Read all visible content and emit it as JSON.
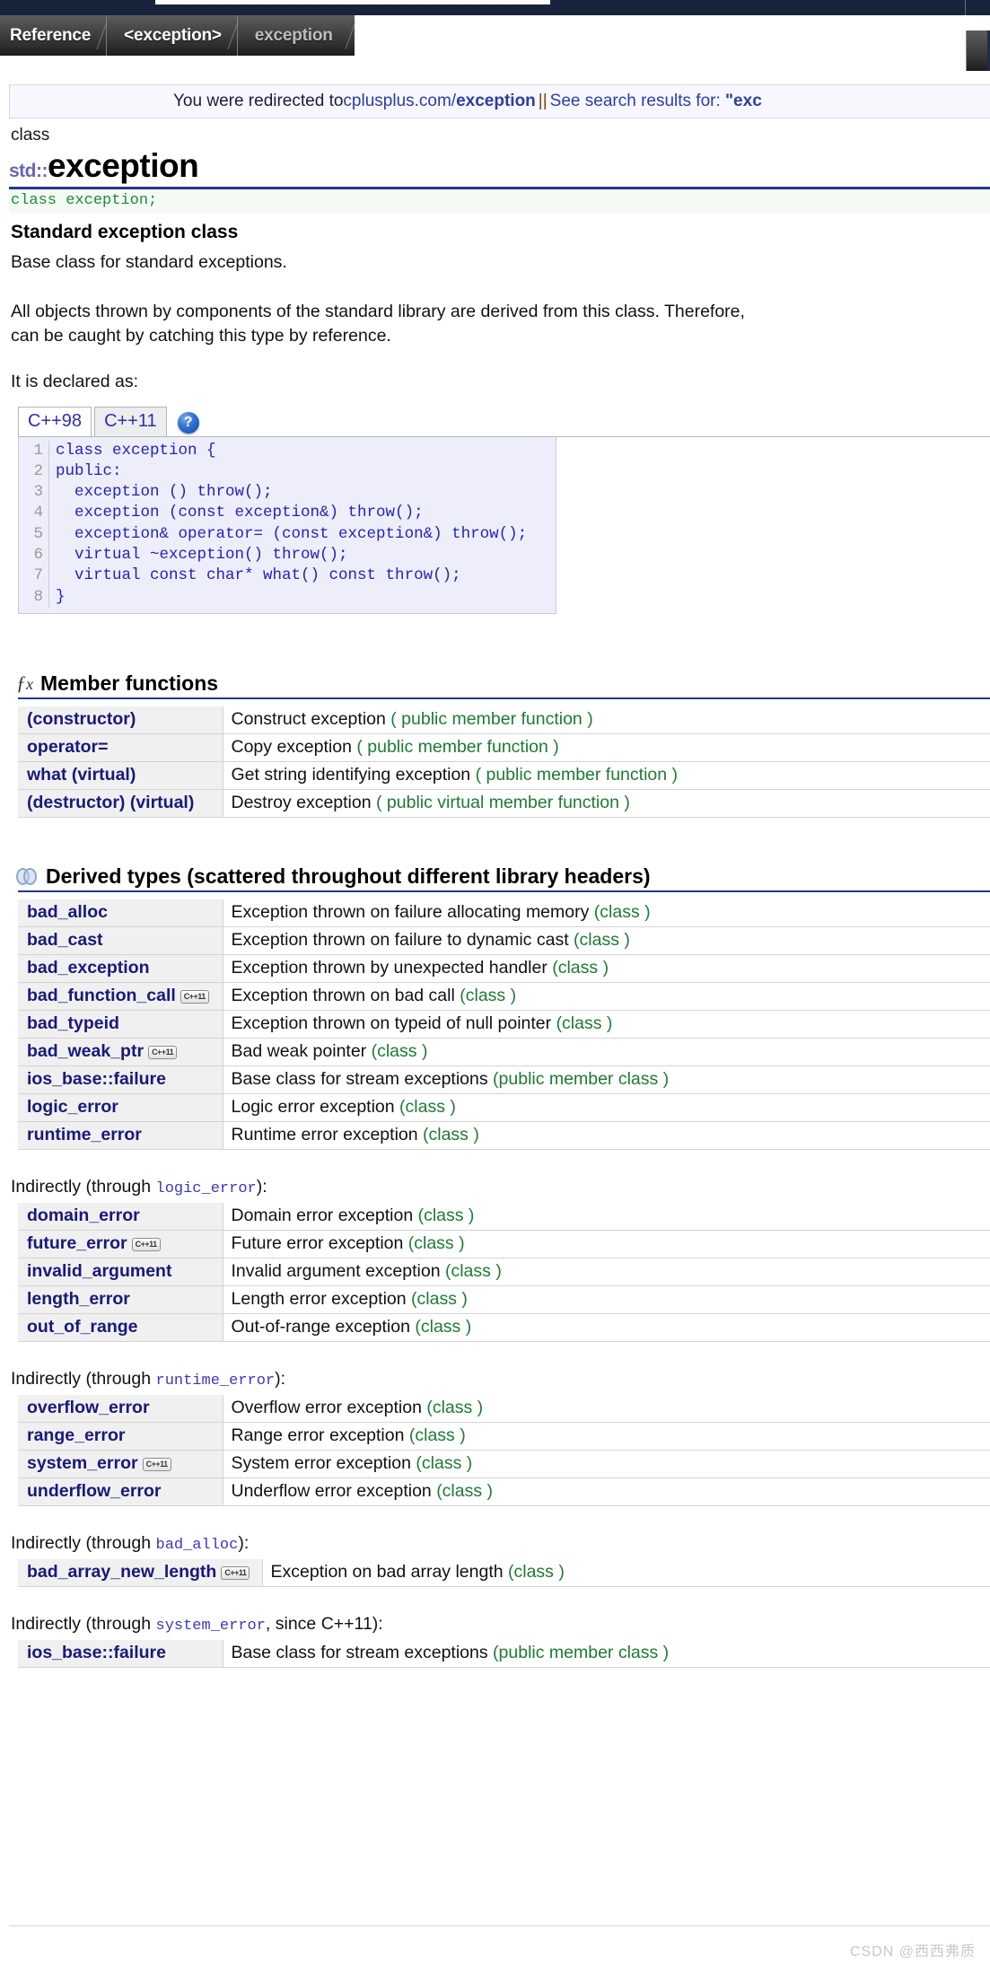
{
  "breadcrumb": {
    "items": [
      {
        "label": "Reference",
        "active": true
      },
      {
        "label": "<exception>",
        "active": true
      },
      {
        "label": "exception",
        "active": false
      }
    ]
  },
  "notice": {
    "prefix": "You were redirected to ",
    "link_plain": "cplusplus.com/",
    "link_bold": "exception",
    "separator": " || ",
    "suffix": "See search results for: ",
    "query": "\"exc"
  },
  "page": {
    "kind": "class",
    "namespace": "std::",
    "name": "exception",
    "declaration": "class exception;",
    "subtitle": "Standard exception class",
    "summary": "Base class for standard exceptions.",
    "paragraph_line1": "All objects thrown by components of the standard library are derived from this class. Therefore,",
    "paragraph_line2": "can be caught by catching this type by reference.",
    "declared_as_label": "It is declared as:"
  },
  "version_tabs": {
    "items": [
      {
        "label": "C++98",
        "selected": true
      },
      {
        "label": "C++11",
        "selected": false
      }
    ],
    "help_glyph": "?"
  },
  "code": {
    "lines": [
      {
        "n": "1",
        "text": "class exception {"
      },
      {
        "n": "2",
        "text": "public:"
      },
      {
        "n": "3",
        "text": "  exception () throw();"
      },
      {
        "n": "4",
        "text": "  exception (const exception&) throw();"
      },
      {
        "n": "5",
        "text": "  exception& operator= (const exception&) throw();"
      },
      {
        "n": "6",
        "text": "  virtual ~exception() throw();"
      },
      {
        "n": "7",
        "text": "  virtual const char* what() const throw();"
      },
      {
        "n": "8",
        "text": "}"
      }
    ]
  },
  "member_functions": {
    "heading": "Member functions",
    "icon": "fx-icon",
    "rows": [
      {
        "name": "(constructor)",
        "desc": "Construct exception ",
        "kind": "( public member function )",
        "cpp11": false
      },
      {
        "name": "operator=",
        "desc": "Copy exception ",
        "kind": "( public member function )",
        "cpp11": false
      },
      {
        "name": "what (virtual)",
        "desc": "Get string identifying exception ",
        "kind": "( public member function )",
        "cpp11": false
      },
      {
        "name": "(destructor) (virtual)",
        "desc": "Destroy exception ",
        "kind": "( public virtual member function )",
        "cpp11": false
      }
    ]
  },
  "derived_types": {
    "heading": "Derived types (scattered throughout different library headers)",
    "icon": "rings-icon",
    "rows": [
      {
        "name": "bad_alloc",
        "desc": "Exception thrown on failure allocating memory ",
        "kind": "(class )",
        "cpp11": false
      },
      {
        "name": "bad_cast",
        "desc": "Exception thrown on failure to dynamic cast ",
        "kind": "(class )",
        "cpp11": false
      },
      {
        "name": "bad_exception",
        "desc": "Exception thrown by unexpected handler ",
        "kind": "(class )",
        "cpp11": false
      },
      {
        "name": "bad_function_call",
        "desc": "Exception thrown on bad call ",
        "kind": "(class )",
        "cpp11": true
      },
      {
        "name": "bad_typeid",
        "desc": "Exception thrown on typeid of null pointer ",
        "kind": "(class )",
        "cpp11": false
      },
      {
        "name": "bad_weak_ptr",
        "desc": "Bad weak pointer ",
        "kind": "(class )",
        "cpp11": true
      },
      {
        "name": "ios_base::failure",
        "desc": "Base class for stream exceptions ",
        "kind": "(public member class )",
        "cpp11": false
      },
      {
        "name": "logic_error",
        "desc": "Logic error exception ",
        "kind": "(class )",
        "cpp11": false
      },
      {
        "name": "runtime_error",
        "desc": "Runtime error exception ",
        "kind": "(class )",
        "cpp11": false
      }
    ]
  },
  "indirect_groups": [
    {
      "label_prefix": "Indirectly (through ",
      "label_mono": "logic_error",
      "label_suffix": "):",
      "rows": [
        {
          "name": "domain_error",
          "desc": "Domain error exception ",
          "kind": "(class )",
          "cpp11": false
        },
        {
          "name": "future_error",
          "desc": "Future error exception ",
          "kind": "(class )",
          "cpp11": true
        },
        {
          "name": "invalid_argument",
          "desc": "Invalid argument exception ",
          "kind": "(class )",
          "cpp11": false
        },
        {
          "name": "length_error",
          "desc": "Length error exception ",
          "kind": "(class )",
          "cpp11": false
        },
        {
          "name": "out_of_range",
          "desc": "Out-of-range exception ",
          "kind": "(class )",
          "cpp11": false
        }
      ]
    },
    {
      "label_prefix": "Indirectly (through ",
      "label_mono": "runtime_error",
      "label_suffix": "):",
      "rows": [
        {
          "name": "overflow_error",
          "desc": "Overflow error exception ",
          "kind": "(class )",
          "cpp11": false
        },
        {
          "name": "range_error",
          "desc": "Range error exception ",
          "kind": "(class )",
          "cpp11": false
        },
        {
          "name": "system_error",
          "desc": "System error exception ",
          "kind": "(class )",
          "cpp11": true
        },
        {
          "name": "underflow_error",
          "desc": "Underflow error exception ",
          "kind": "(class )",
          "cpp11": false
        }
      ]
    },
    {
      "label_prefix": "Indirectly (through ",
      "label_mono": "bad_alloc",
      "label_suffix": "):",
      "rows": [
        {
          "name": "bad_array_new_length",
          "desc": "Exception on bad array length ",
          "kind": "(class )",
          "cpp11": true,
          "namecell_width": 272
        }
      ]
    },
    {
      "label_prefix": "Indirectly (through ",
      "label_mono": "system_error",
      "label_suffix": ", since C++11):",
      "rows": [
        {
          "name": "ios_base::failure",
          "desc": "Base class for stream exceptions ",
          "kind": "(public member class )",
          "cpp11": false
        }
      ]
    }
  ],
  "watermark": {
    "text": "CSDN @西西弗质"
  },
  "colors": {
    "accent_rule": "#23388e",
    "link": "#19197a",
    "kind_green": "#1f7a34",
    "decl_green": "#1f8a3b",
    "namespace_purple": "#6b66b3",
    "topbar_dark": "#17243b",
    "code_bg": "#eeeefb"
  },
  "badge_text": "C++11"
}
